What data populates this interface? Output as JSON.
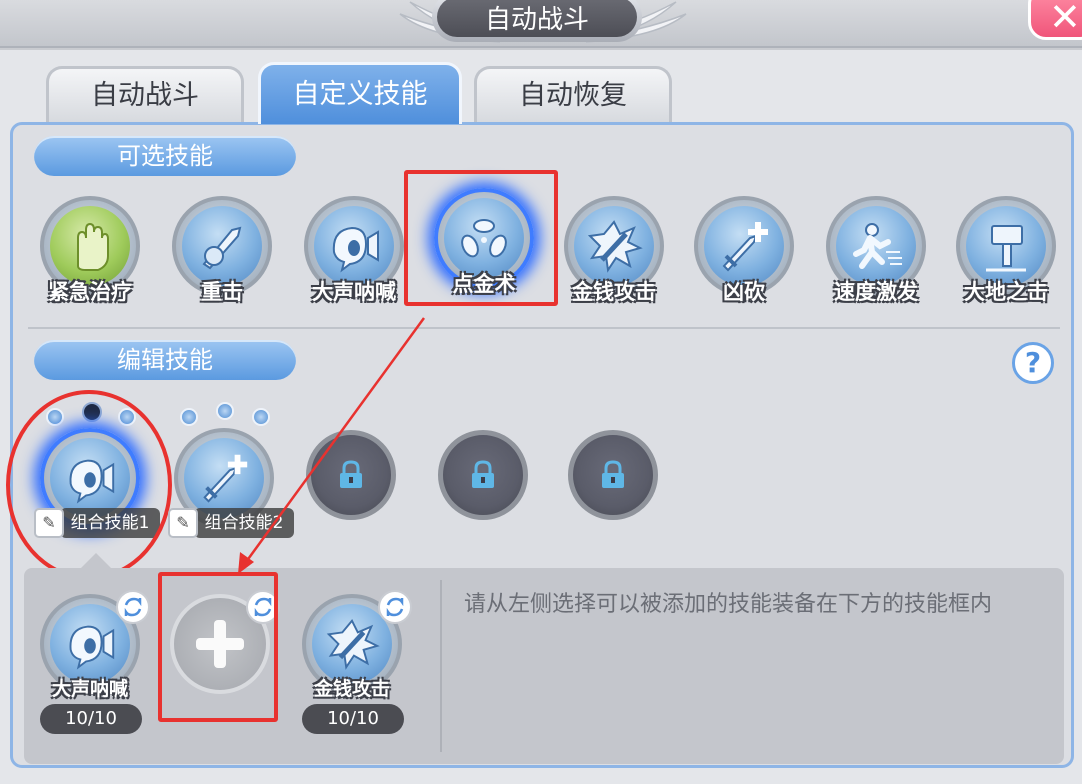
{
  "header": {
    "title": "自动战斗",
    "close_icon": "close-icon"
  },
  "tabs": [
    {
      "label": "自动战斗",
      "active": false
    },
    {
      "label": "自定义技能",
      "active": true
    },
    {
      "label": "自动恢复",
      "active": false
    }
  ],
  "available_skills": {
    "section_label": "可选技能",
    "items": [
      {
        "name": "紧急治疗",
        "icon": "hand-icon"
      },
      {
        "name": "重击",
        "icon": "sword-strike-icon"
      },
      {
        "name": "大声呐喊",
        "icon": "shout-icon"
      },
      {
        "name": "点金术",
        "icon": "alchemy-icon",
        "selected": true
      },
      {
        "name": "金钱攻击",
        "icon": "money-attack-icon"
      },
      {
        "name": "凶砍",
        "icon": "sword-plus-icon"
      },
      {
        "name": "速度激发",
        "icon": "runner-icon"
      },
      {
        "name": "大地之击",
        "icon": "hammer-icon"
      }
    ]
  },
  "edit_skills": {
    "section_label": "编辑技能",
    "help_label": "?",
    "combos": [
      {
        "label": "组合技能1",
        "icon": "shout-icon",
        "selected": true
      },
      {
        "label": "组合技能2",
        "icon": "sword-plus-icon",
        "selected": false
      }
    ],
    "locked_count": 3
  },
  "editor": {
    "hint": "请从左侧选择可以被添加的技能装备在下方的技能框内",
    "slots": [
      {
        "name": "大声呐喊",
        "uses": "10/10",
        "icon": "shout-icon"
      },
      {
        "name": "",
        "uses": "",
        "icon": "plus-icon"
      },
      {
        "name": "金钱攻击",
        "uses": "10/10",
        "icon": "money-attack-icon"
      }
    ]
  },
  "colors": {
    "accent": "#5b9ae0",
    "highlight": "#e8322f",
    "selected_glow": "#2f6dff"
  }
}
